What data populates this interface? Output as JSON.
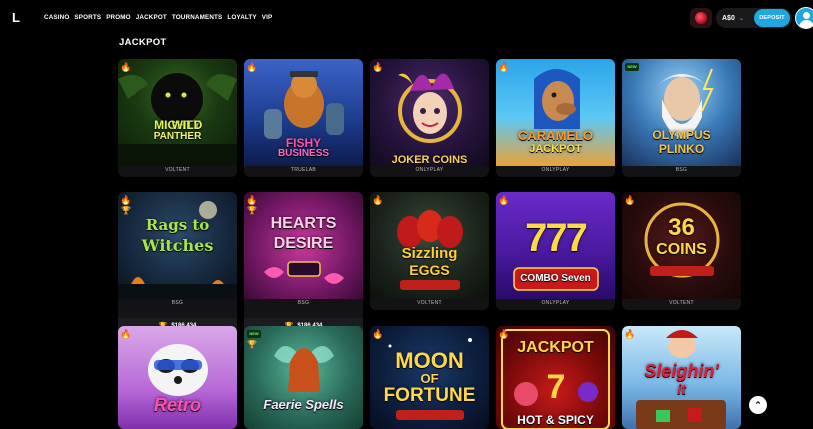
{
  "header": {
    "logo": "L",
    "nav": [
      "CASINO",
      "SPORTS",
      "PROMO",
      "JACKPOT",
      "TOURNAMENTS",
      "LOYALTY",
      "VIP"
    ],
    "currency": "A$0",
    "deposit_label": "DEPOSIT"
  },
  "section": {
    "title": "JACKPOT"
  },
  "games": [
    {
      "title_lines": [
        "MIGHTY",
        "WILD",
        "PANTHER"
      ],
      "provider": "VOLTENT",
      "badge": "fire"
    },
    {
      "title_lines": [
        "FISHY",
        "BUSINESS"
      ],
      "provider": "TRUELAB",
      "badge": "fire"
    },
    {
      "title_lines": [
        "JOKER COINS"
      ],
      "provider": "ONLYPLAY",
      "badge": "fire"
    },
    {
      "title_lines": [
        "CARAMELO",
        "JACKPOT"
      ],
      "provider": "ONLYPLAY",
      "badge": "fire"
    },
    {
      "title_lines": [
        "OLYMPUS",
        "PLINKO"
      ],
      "provider": "BSG",
      "badge": "new",
      "badge_text": "NEW"
    },
    {
      "title_lines": [
        "Rags to",
        "Witches"
      ],
      "provider": "BSG",
      "badge": "fire",
      "jackpot": "$186,434"
    },
    {
      "title_lines": [
        "HEARTS",
        "DESIRE"
      ],
      "provider": "BSG",
      "badge": "fire",
      "jackpot": "$186,434"
    },
    {
      "title_lines": [
        "Sizzling",
        "EGGS"
      ],
      "provider": "VOLTENT",
      "badge": "fire"
    },
    {
      "title_lines": [
        "777",
        "COMBO Seven"
      ],
      "provider": "ONLYPLAY",
      "badge": "fire"
    },
    {
      "title_lines": [
        "36",
        "COINS"
      ],
      "provider": "VOLTENT",
      "badge": "fire"
    },
    {
      "title_lines": [
        "Retro"
      ],
      "provider": "",
      "badge": "fire"
    },
    {
      "title_lines": [
        "Faerie Spells"
      ],
      "provider": "",
      "badge": "new",
      "badge_text": "NEW"
    },
    {
      "title_lines": [
        "MOON",
        "OF",
        "FORTUNE"
      ],
      "provider": "",
      "badge": "fire"
    },
    {
      "title_lines": [
        "JACKPOT",
        "HOT & SPICY"
      ],
      "provider": "",
      "badge": "fire"
    },
    {
      "title_lines": [
        "Sleighin'",
        "it"
      ],
      "provider": "",
      "badge": "fire"
    }
  ],
  "colors": {
    "accent": "#1fa8e0",
    "trophy": "#f2b01c",
    "background": "#000000"
  },
  "icons": {
    "hot": "fire-icon",
    "jackpot": "trophy-icon",
    "scroll": "chevron-up-icon"
  }
}
